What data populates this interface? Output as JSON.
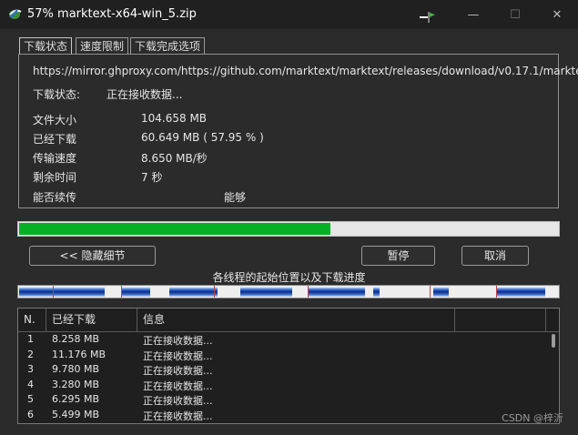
{
  "window": {
    "title": "57% marktext-x64-win_5.zip",
    "controls": {
      "minimize": "—",
      "maximize": "☐",
      "close": "✕"
    }
  },
  "tabs": [
    {
      "label": "下载状态",
      "active": true
    },
    {
      "label": "速度限制",
      "active": false
    },
    {
      "label": "下载完成选项",
      "active": false
    }
  ],
  "status": {
    "url": "https://mirror.ghproxy.com/https://github.com/marktext/marktext/releases/download/v0.17.1/markte",
    "state_label": "下载状态:",
    "state_value": "正在接收数据...",
    "file_size_label": "文件大小",
    "file_size_value": "104.658  MB",
    "downloaded_label": "已经下载",
    "downloaded_value": "60.649  MB  ( 57.95 % )",
    "speed_label": "传输速度",
    "speed_value": "8.650  MB/秒",
    "remaining_label": "剩余时间",
    "remaining_value": "7 秒",
    "resume_label": "能否续传",
    "resume_value": "能够"
  },
  "progress": {
    "percent": 57.95,
    "color": "#06b025"
  },
  "buttons": {
    "hide_details": "<< 隐藏细节",
    "pause": "暂停",
    "cancel": "取消"
  },
  "segments_label": "各线程的起始位置以及下载进度",
  "table": {
    "headers": [
      "N.",
      "已经下载",
      "信息"
    ],
    "rows": [
      {
        "n": "1",
        "downloaded": "8.258  MB",
        "info": "正在接收数据..."
      },
      {
        "n": "2",
        "downloaded": "11.176  MB",
        "info": "正在接收数据..."
      },
      {
        "n": "3",
        "downloaded": "9.780  MB",
        "info": "正在接收数据..."
      },
      {
        "n": "4",
        "downloaded": "3.280  MB",
        "info": "正在接收数据..."
      },
      {
        "n": "5",
        "downloaded": "6.295  MB",
        "info": "正在接收数据..."
      },
      {
        "n": "6",
        "downloaded": "5.499  MB",
        "info": "正在接收数据..."
      }
    ]
  },
  "watermark": "CSDN @梓沂"
}
